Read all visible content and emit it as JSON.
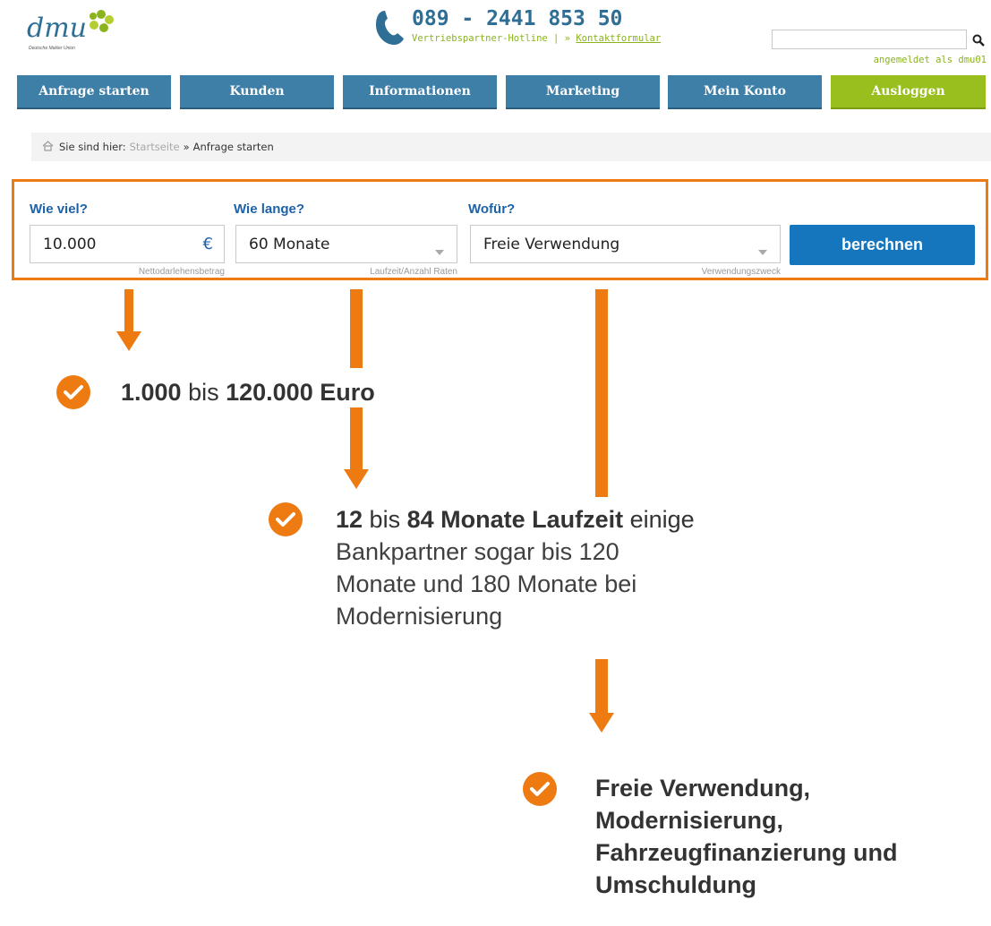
{
  "header": {
    "logo_text": "dmu",
    "logo_sub": "Deutsche Makler Union",
    "hotline_number": "089 - 2441 853 50",
    "hotline_label": "Vertriebspartner-Hotline | »",
    "contact_link": "Kontaktformular",
    "search_placeholder": "",
    "logged_in_text": "angemeldet als dmu01"
  },
  "nav": {
    "items": [
      {
        "label": "Anfrage starten"
      },
      {
        "label": "Kunden"
      },
      {
        "label": "Informationen"
      },
      {
        "label": "Marketing"
      },
      {
        "label": "Mein Konto"
      },
      {
        "label": "Ausloggen"
      }
    ]
  },
  "breadcrumb": {
    "prefix": "Sie sind hier:",
    "home_link": "Startseite",
    "separator": "»",
    "current": "Anfrage starten"
  },
  "form": {
    "amount": {
      "label": "Wie viel?",
      "value": "10.000",
      "currency": "€",
      "hint": "Nettodarlehensbetrag"
    },
    "duration": {
      "label": "Wie lange?",
      "value": "60 Monate",
      "hint": "Laufzeit/Anzahl Raten"
    },
    "purpose": {
      "label": "Wofür?",
      "value": "Freie Verwendung",
      "hint": "Verwendungszweck"
    },
    "submit_label": "berechnen"
  },
  "annotations": {
    "amount": {
      "bold1": "1.000",
      "text1": " bis ",
      "bold2": "120.000 Euro"
    },
    "duration": {
      "bold1": "12",
      "text1": " bis ",
      "bold2": "84 Monate Laufzeit",
      "text2": " einige",
      "line2": "Bankpartner sogar bis 120",
      "line3": "Monate und 180 Monate bei",
      "line4": "Modernisierung"
    },
    "purpose": {
      "line1": "Freie Verwendung,",
      "line2": "Modernisierung,",
      "line3": "Fahrzeugfinanzierung und",
      "line4": "Umschuldung"
    }
  },
  "colors": {
    "accent_orange": "#ee7a12",
    "nav_blue": "#3e7fa8",
    "logout_green": "#99bf1e",
    "button_blue": "#1575bd",
    "label_blue": "#1d62a8"
  },
  "icons": [
    "phone-icon",
    "search-icon",
    "home-icon",
    "check-circle-icon",
    "dropdown-caret-icon",
    "arrow-down-icon"
  ]
}
